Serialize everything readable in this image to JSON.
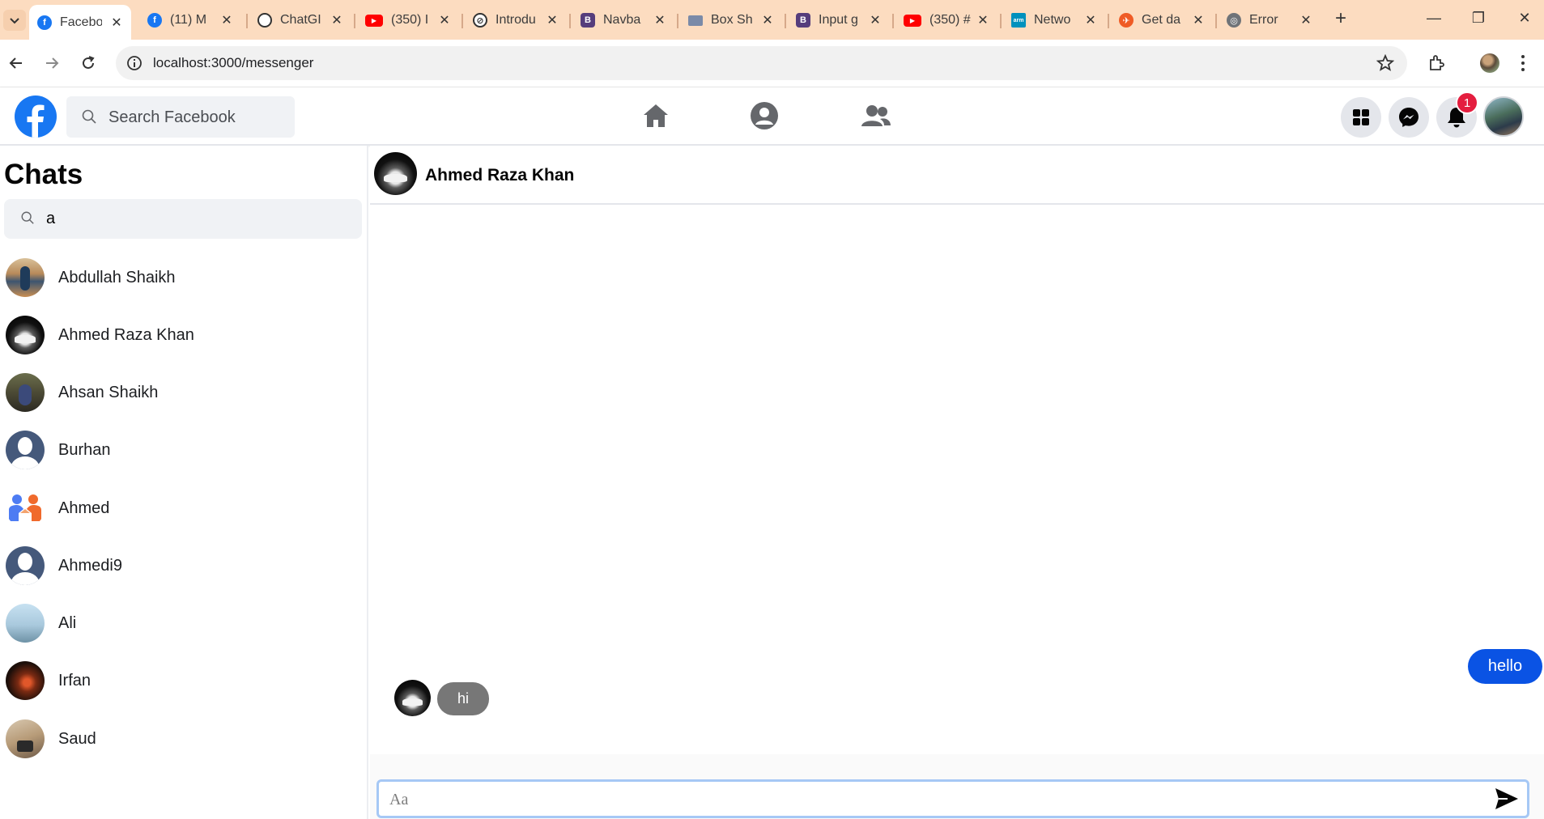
{
  "browser": {
    "tabs": [
      {
        "title": "Facebo",
        "favicon": "facebook-favicon",
        "active": true
      },
      {
        "title": "(11) M",
        "favicon": "facebook-favicon",
        "active": false
      },
      {
        "title": "ChatGI",
        "favicon": "chatgpt-favicon",
        "active": false
      },
      {
        "title": "(350) I",
        "favicon": "youtube-favicon",
        "active": false
      },
      {
        "title": "Introdu",
        "favicon": "compass-favicon",
        "active": false
      },
      {
        "title": "Navba",
        "favicon": "bootstrap-favicon",
        "active": false
      },
      {
        "title": "Box Sh",
        "favicon": "box-shadow-favicon",
        "active": false
      },
      {
        "title": "Input g",
        "favicon": "bootstrap-favicon",
        "active": false
      },
      {
        "title": "(350) #",
        "favicon": "youtube-favicon",
        "active": false
      },
      {
        "title": "Netwo",
        "favicon": "arm-favicon",
        "active": false
      },
      {
        "title": "Get da",
        "favicon": "postman-favicon",
        "active": false
      },
      {
        "title": "Error",
        "favicon": "globe-favicon",
        "active": false
      }
    ],
    "url": "localhost:3000/messenger",
    "colors": {
      "tabstrip": "#fcdcc0",
      "youtube": "#ff0000",
      "bootstrap": "#563d7c",
      "facebook": "#1877f2"
    }
  },
  "header": {
    "search_placeholder": "Search Facebook",
    "notification_count": "1",
    "colors": {
      "brand": "#1877f2",
      "badge": "#e41e3f"
    }
  },
  "sidebar": {
    "title": "Chats",
    "search_value": "a",
    "chats": [
      {
        "name": "Abdullah Shaikh",
        "avatar": "photo"
      },
      {
        "name": "Ahmed Raza Khan",
        "avatar": "car-photo"
      },
      {
        "name": "Ahsan Shaikh",
        "avatar": "photo"
      },
      {
        "name": "Burhan",
        "avatar": "default"
      },
      {
        "name": "Ahmed",
        "avatar": "friends-icon"
      },
      {
        "name": "Ahmedi9",
        "avatar": "default"
      },
      {
        "name": "Ali",
        "avatar": "photo"
      },
      {
        "name": "Irfan",
        "avatar": "photo"
      },
      {
        "name": "Saud",
        "avatar": "photo"
      }
    ]
  },
  "conversation": {
    "contact_name": "Ahmed Raza Khan",
    "messages": [
      {
        "direction": "outgoing",
        "text": "hello"
      },
      {
        "direction": "incoming",
        "text": "hi"
      }
    ],
    "composer_placeholder": "Aa",
    "colors": {
      "outgoing_bubble": "#0a53e4",
      "incoming_bubble": "#777777"
    }
  }
}
